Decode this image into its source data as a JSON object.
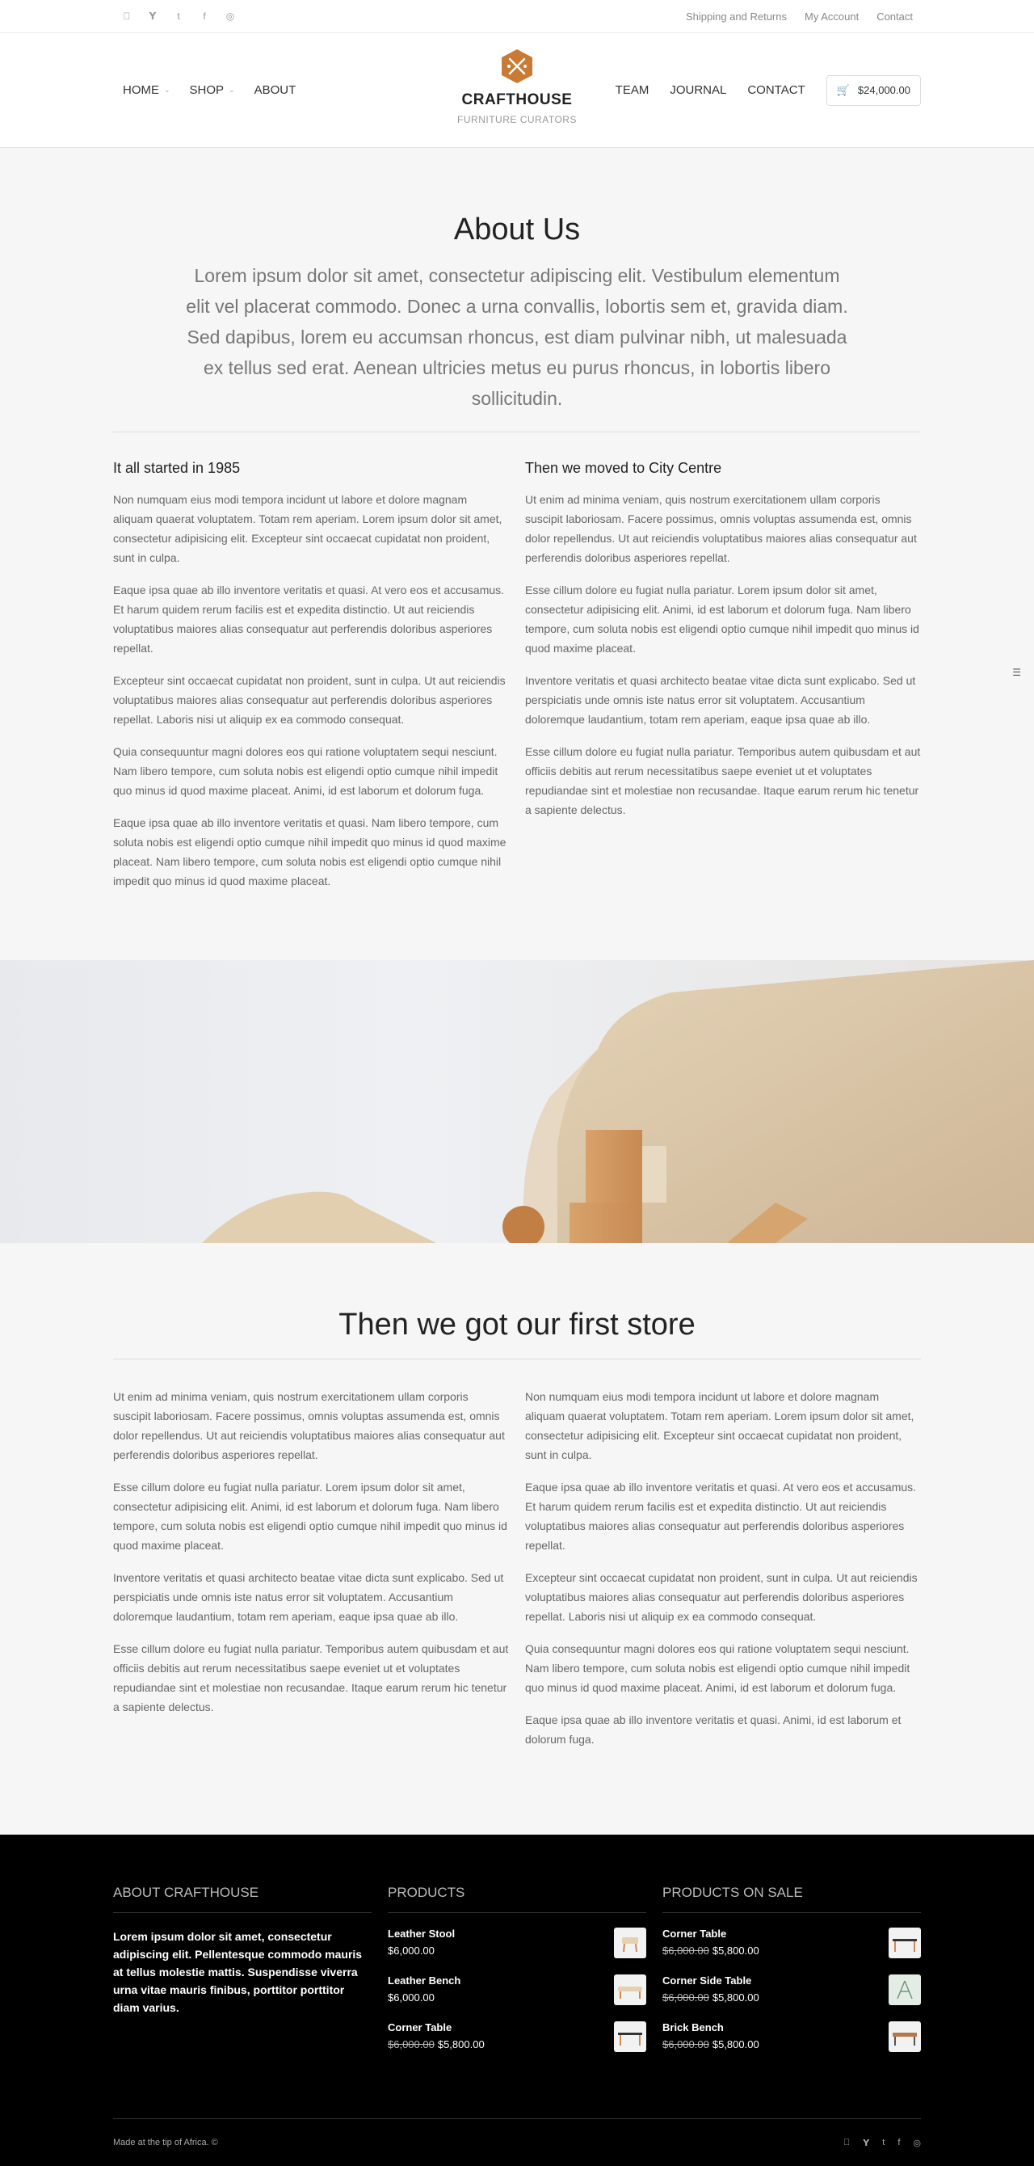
{
  "topbar": {
    "social_icons": [
      "apple-icon",
      "twitter-icon",
      "tumblr-icon",
      "facebook-icon",
      "dribbble-icon"
    ],
    "links": [
      "Shipping and Returns",
      "My Account",
      "Contact"
    ]
  },
  "header": {
    "nav_left": [
      {
        "label": "HOME",
        "has_dropdown": true
      },
      {
        "label": "SHOP",
        "has_dropdown": true
      },
      {
        "label": "ABOUT",
        "has_dropdown": false
      }
    ],
    "logo_name": "CRAFTHOUSE",
    "logo_sub": "FURNITURE CURATORS",
    "nav_right": [
      "TEAM",
      "JOURNAL",
      "CONTACT"
    ],
    "cart_total": "$24,000.00",
    "accent": "#c97a34"
  },
  "about": {
    "title": "About Us",
    "lead": "Lorem ipsum dolor sit amet, consectetur adipiscing elit. Vestibulum elementum elit vel placerat commodo. Donec a urna convallis, lobortis sem et, gravida diam. Sed dapibus, lorem eu accumsan rhoncus, est diam pulvinar nibh, ut malesuada ex tellus sed erat. Aenean ultricies metus eu purus rhoncus, in lobortis libero sollicitudin.",
    "left": {
      "heading": "It all started in 1985",
      "paragraphs": [
        "Non numquam eius modi tempora incidunt ut labore et dolore magnam aliquam quaerat voluptatem. Totam rem aperiam. Lorem ipsum dolor sit amet, consectetur adipisicing elit. Excepteur sint occaecat cupidatat non proident, sunt in culpa.",
        "Eaque ipsa quae ab illo inventore veritatis et quasi. At vero eos et accusamus. Et harum quidem rerum facilis est et expedita distinctio. Ut aut reiciendis voluptatibus maiores alias consequatur aut perferendis doloribus asperiores repellat.",
        "Excepteur sint occaecat cupidatat non proident, sunt in culpa. Ut aut reiciendis voluptatibus maiores alias consequatur aut perferendis doloribus asperiores repellat. Laboris nisi ut aliquip ex ea commodo consequat.",
        "Quia consequuntur magni dolores eos qui ratione voluptatem sequi nesciunt. Nam libero tempore, cum soluta nobis est eligendi optio cumque nihil impedit quo minus id quod maxime placeat. Animi, id est laborum et dolorum fuga.",
        "Eaque ipsa quae ab illo inventore veritatis et quasi. Nam libero tempore, cum soluta nobis est eligendi optio cumque nihil impedit quo minus id quod maxime placeat. Nam libero tempore, cum soluta nobis est eligendi optio cumque nihil impedit quo minus id quod maxime placeat."
      ]
    },
    "right": {
      "heading": "Then we moved to City Centre",
      "paragraphs": [
        "Ut enim ad minima veniam, quis nostrum exercitationem ullam corporis suscipit laboriosam. Facere possimus, omnis voluptas assumenda est, omnis dolor repellendus. Ut aut reiciendis voluptatibus maiores alias consequatur aut perferendis doloribus asperiores repellat.",
        "Esse cillum dolore eu fugiat nulla pariatur. Lorem ipsum dolor sit amet, consectetur adipisicing elit. Animi, id est laborum et dolorum fuga. Nam libero tempore, cum soluta nobis est eligendi optio cumque nihil impedit quo minus id quod maxime placeat.",
        "Inventore veritatis et quasi architecto beatae vitae dicta sunt explicabo. Sed ut perspiciatis unde omnis iste natus error sit voluptatem. Accusantium doloremque laudantium, totam rem aperiam, eaque ipsa quae ab illo.",
        "Esse cillum dolore eu fugiat nulla pariatur. Temporibus autem quibusdam et aut officiis debitis aut rerum necessitatibus saepe eveniet ut et voluptates repudiandae sint et molestiae non recusandae. Itaque earum rerum hic tenetur a sapiente delectus."
      ]
    }
  },
  "store": {
    "title": "Then we got our first store",
    "left": [
      "Ut enim ad minima veniam, quis nostrum exercitationem ullam corporis suscipit laboriosam. Facere possimus, omnis voluptas assumenda est, omnis dolor repellendus. Ut aut reiciendis voluptatibus maiores alias consequatur aut perferendis doloribus asperiores repellat.",
      "Esse cillum dolore eu fugiat nulla pariatur. Lorem ipsum dolor sit amet, consectetur adipisicing elit. Animi, id est laborum et dolorum fuga. Nam libero tempore, cum soluta nobis est eligendi optio cumque nihil impedit quo minus id quod maxime placeat.",
      "Inventore veritatis et quasi architecto beatae vitae dicta sunt explicabo. Sed ut perspiciatis unde omnis iste natus error sit voluptatem. Accusantium doloremque laudantium, totam rem aperiam, eaque ipsa quae ab illo.",
      "Esse cillum dolore eu fugiat nulla pariatur. Temporibus autem quibusdam et aut officiis debitis aut rerum necessitatibus saepe eveniet ut et voluptates repudiandae sint et molestiae non recusandae. Itaque earum rerum hic tenetur a sapiente delectus."
    ],
    "right": [
      "Non numquam eius modi tempora incidunt ut labore et dolore magnam aliquam quaerat voluptatem. Totam rem aperiam. Lorem ipsum dolor sit amet, consectetur adipisicing elit. Excepteur sint occaecat cupidatat non proident, sunt in culpa.",
      "Eaque ipsa quae ab illo inventore veritatis et quasi. At vero eos et accusamus. Et harum quidem rerum facilis est et expedita distinctio. Ut aut reiciendis voluptatibus maiores alias consequatur aut perferendis doloribus asperiores repellat.",
      "Excepteur sint occaecat cupidatat non proident, sunt in culpa. Ut aut reiciendis voluptatibus maiores alias consequatur aut perferendis doloribus asperiores repellat. Laboris nisi ut aliquip ex ea commodo consequat.",
      "Quia consequuntur magni dolores eos qui ratione voluptatem sequi nesciunt. Nam libero tempore, cum soluta nobis est eligendi optio cumque nihil impedit quo minus id quod maxime placeat. Animi, id est laborum et dolorum fuga.",
      "Eaque ipsa quae ab illo inventore veritatis et quasi. Animi, id est laborum et dolorum fuga."
    ]
  },
  "footer": {
    "about_title": "ABOUT CRAFTHOUSE",
    "about_text": "Lorem ipsum dolor sit amet, consectetur adipiscing elit. Pellentesque commodo mauris at tellus molestie mattis. Suspendisse viverra urna vitae mauris finibus, porttitor porttitor diam varius.",
    "products_title": "PRODUCTS",
    "products": [
      {
        "name": "Leather Stool",
        "price": "$6,000.00",
        "icon": "stool-icon"
      },
      {
        "name": "Leather Bench",
        "price": "$6,000.00",
        "icon": "bench-icon"
      },
      {
        "name": "Corner Table",
        "old_price": "$6,000.00",
        "price": "$5,800.00",
        "icon": "table-icon"
      }
    ],
    "sale_title": "PRODUCTS ON SALE",
    "sale": [
      {
        "name": "Corner Table",
        "old_price": "$6,000.00",
        "price": "$5,800.00",
        "icon": "table-icon"
      },
      {
        "name": "Corner Side Table",
        "old_price": "$6,000.00",
        "price": "$5,800.00",
        "icon": "side-table-icon"
      },
      {
        "name": "Brick Bench",
        "old_price": "$6,000.00",
        "price": "$5,800.00",
        "icon": "bench-icon"
      }
    ],
    "made": "Made at the tip of Africa. ©",
    "social_icons": [
      "apple-icon",
      "twitter-icon",
      "tumblr-icon",
      "facebook-icon",
      "dribbble-icon"
    ]
  }
}
